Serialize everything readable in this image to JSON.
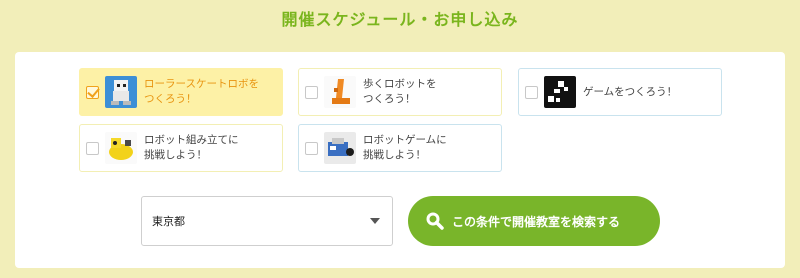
{
  "header": {
    "title": "開催スケジュール・お申し込み"
  },
  "courses": [
    {
      "label": "ローラースケートロボを\nつくろう！",
      "checked": true,
      "icon": "roller-skate-robot-icon"
    },
    {
      "label": "歩くロボットを\nつくろう！",
      "checked": false,
      "icon": "walking-robot-icon"
    },
    {
      "label": "ゲームをつくろう！",
      "checked": false,
      "icon": "game-icon"
    },
    {
      "label": "ロボット組み立てに\n挑戦しよう！",
      "checked": false,
      "icon": "robot-assembly-icon"
    },
    {
      "label": "ロボットゲームに\n挑戦しよう！",
      "checked": false,
      "icon": "robot-game-icon"
    }
  ],
  "region_select": {
    "value": "東京都"
  },
  "search": {
    "label": "この条件で開催教室を検索する",
    "icon": "search-icon"
  },
  "colors": {
    "accent": "#79b52a",
    "title": "#7ab51d",
    "selected_bg": "#fdf1a6",
    "check": "#f0a21b"
  }
}
